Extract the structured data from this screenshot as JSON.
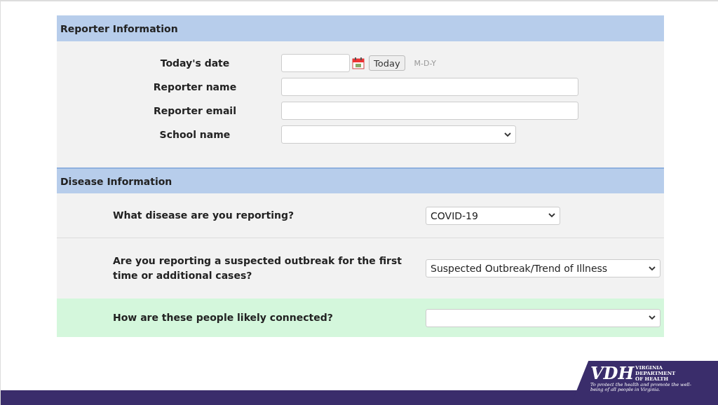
{
  "sections": [
    {
      "title": "Reporter Information",
      "kind": "reporter",
      "rows": [
        {
          "label": "Today's date",
          "kind": "date",
          "button": "Today",
          "hint": "M-D-Y"
        },
        {
          "label": "Reporter name",
          "kind": "text"
        },
        {
          "label": "Reporter email",
          "kind": "text"
        },
        {
          "label": "School name",
          "kind": "select"
        }
      ]
    },
    {
      "title": "Disease Information",
      "kind": "disease",
      "rows": [
        {
          "label": "What disease are you reporting?",
          "kind": "select",
          "value": "COVID-19",
          "highlighted": false
        },
        {
          "label": "Are you reporting a suspected outbreak for the first time or additional cases?",
          "kind": "select",
          "value": "Suspected Outbreak/Trend of Illness",
          "highlighted": false
        },
        {
          "label": "How are these people likely connected?",
          "kind": "select",
          "highlighted": true
        }
      ]
    }
  ],
  "logo": {
    "mark": "VDH",
    "name": [
      "VIRGINIA",
      "DEPARTMENT",
      "OF HEALTH"
    ],
    "tagline": "To protect the health and promote the well-being of all people in Virginia."
  }
}
